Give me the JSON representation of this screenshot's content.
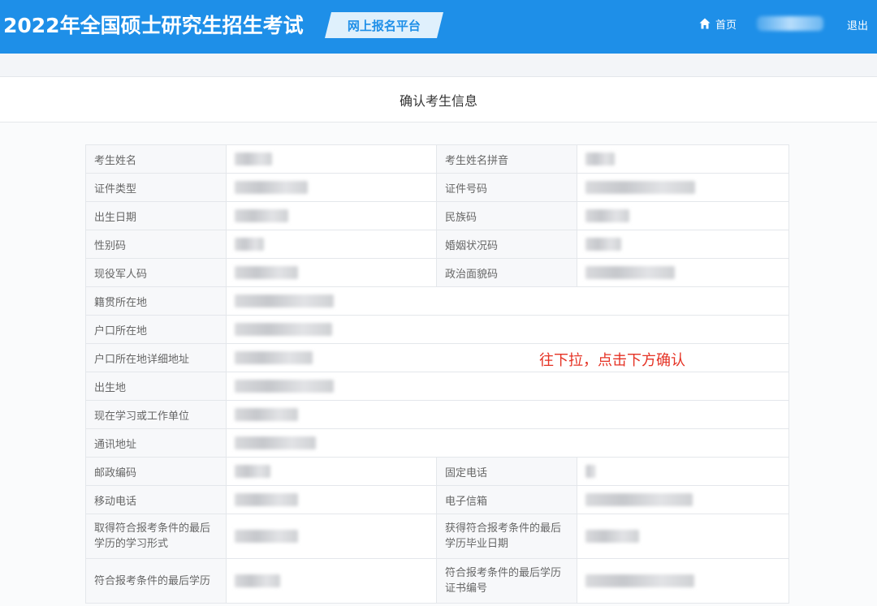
{
  "header": {
    "title": "2022年全国硕士研究生招生考试",
    "platform": "网上报名平台",
    "home_label": "首页",
    "logout_label": "退出"
  },
  "section_title": "确认考生信息",
  "hint": "往下拉，点击下方确认",
  "fields": {
    "name": "考生姓名",
    "name_pinyin": "考生姓名拼音",
    "id_type": "证件类型",
    "id_number": "证件号码",
    "birth_date": "出生日期",
    "ethnicity": "民族码",
    "gender": "性别码",
    "marital": "婚姻状况码",
    "military": "现役军人码",
    "political": "政治面貌码",
    "native_place": "籍贯所在地",
    "hukou": "户口所在地",
    "hukou_address": "户口所在地详细地址",
    "birthplace": "出生地",
    "workplace": "现在学习或工作单位",
    "mail_address": "通讯地址",
    "postcode": "邮政编码",
    "phone": "固定电话",
    "mobile": "移动电话",
    "email": "电子信箱",
    "study_form": "取得符合报考条件的最后学历的学习形式",
    "grad_date": "获得符合报考条件的最后学历毕业日期",
    "last_degree": "符合报考条件的最后学历",
    "cert_number": "符合报考条件的最后学历证书编号"
  },
  "colors": {
    "brand": "#1e8fe8",
    "hint": "#e53224"
  },
  "icons": [
    "home-icon"
  ]
}
